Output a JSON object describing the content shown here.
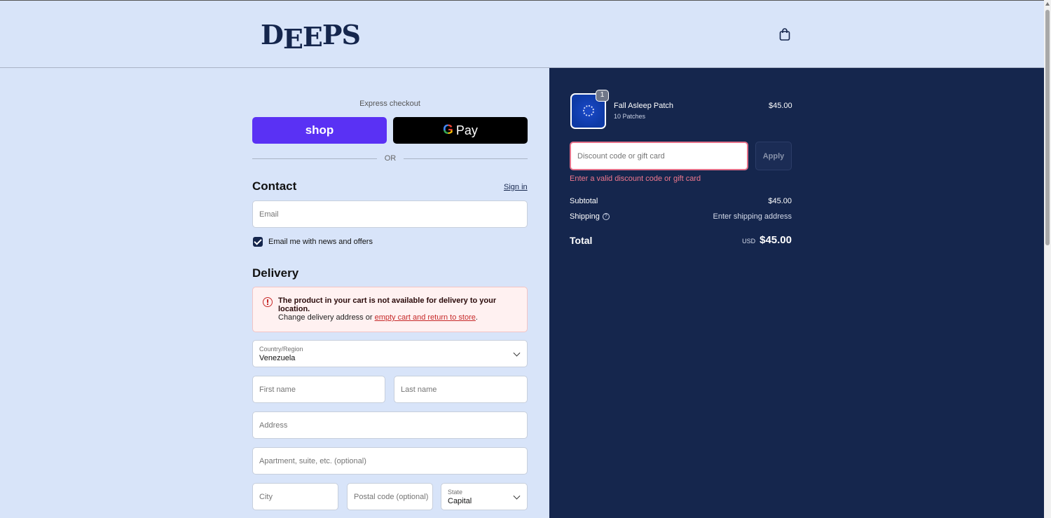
{
  "header": {
    "logo": [
      "D",
      "E",
      "E",
      "P",
      "S"
    ],
    "cart_icon": "shopping-bag-icon"
  },
  "express": {
    "label": "Express checkout",
    "shop_label": "shop",
    "gpay_g": "G",
    "gpay_label": "Pay",
    "or_label": "OR"
  },
  "contact": {
    "title": "Contact",
    "sign_in": "Sign in",
    "email_placeholder": "Email",
    "newsletter_label": "Email me with news and offers",
    "newsletter_checked": true
  },
  "delivery": {
    "title": "Delivery",
    "alert_title": "The product in your cart is not available for delivery to your location.",
    "alert_body_prefix": "Change delivery address or ",
    "alert_link": "empty cart and return to store",
    "alert_body_suffix": ".",
    "country_label": "Country/Region",
    "country_value": "Venezuela",
    "first_name_placeholder": "First name",
    "last_name_placeholder": "Last name",
    "address_placeholder": "Address",
    "apartment_placeholder": "Apartment, suite, etc. (optional)",
    "city_placeholder": "City",
    "postal_placeholder": "Postal code (optional)",
    "state_label": "State",
    "state_value": "Capital"
  },
  "summary": {
    "item": {
      "name": "Fall Asleep Patch",
      "variant": "10 Patches",
      "price": "$45.00",
      "quantity": "1"
    },
    "discount_placeholder": "Discount code or gift card",
    "apply_label": "Apply",
    "discount_error": "Enter a valid discount code or gift card",
    "subtotal_label": "Subtotal",
    "subtotal_value": "$45.00",
    "shipping_label": "Shipping",
    "shipping_help": "?",
    "shipping_value": "Enter shipping address",
    "total_label": "Total",
    "total_currency": "USD",
    "total_value": "$45.00"
  },
  "colors": {
    "brand_navy": "#15264d",
    "shop_purple": "#5a31f4",
    "error_red": "#c62828",
    "page_bg": "#d8e4f9"
  }
}
